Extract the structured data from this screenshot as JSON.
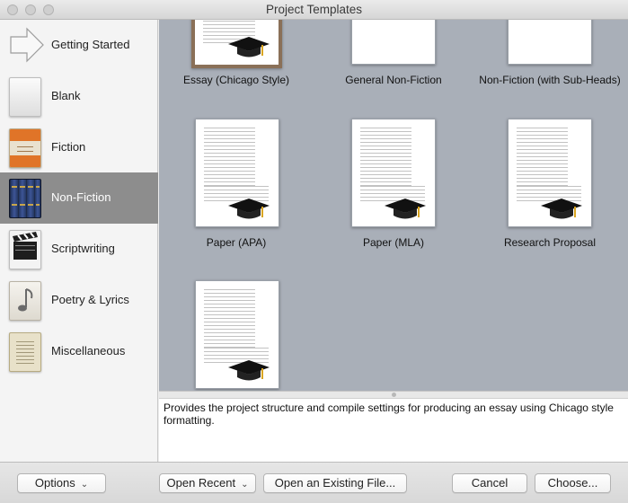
{
  "window": {
    "title": "Project Templates"
  },
  "sidebar": {
    "items": [
      {
        "label": "Getting Started",
        "icon": "arrow-icon"
      },
      {
        "label": "Blank",
        "icon": "blank-page-icon"
      },
      {
        "label": "Fiction",
        "icon": "fiction-book-icon"
      },
      {
        "label": "Non-Fiction",
        "icon": "nonfiction-books-icon",
        "selected": true
      },
      {
        "label": "Scriptwriting",
        "icon": "clapperboard-icon"
      },
      {
        "label": "Poetry & Lyrics",
        "icon": "music-note-icon"
      },
      {
        "label": "Miscellaneous",
        "icon": "parchment-icon"
      }
    ]
  },
  "templates": [
    {
      "label": "Essay (Chicago Style)",
      "selected": true
    },
    {
      "label": "General Non-Fiction"
    },
    {
      "label": "Non-Fiction (with Sub-Heads)"
    },
    {
      "label": "Paper (APA)"
    },
    {
      "label": "Paper (MLA)"
    },
    {
      "label": "Research Proposal"
    },
    {
      "label": ""
    }
  ],
  "description": "Provides the project structure and compile settings for producing an essay using Chicago style formatting.",
  "footer": {
    "options": "Options",
    "open_recent": "Open Recent",
    "open_existing": "Open an Existing File...",
    "cancel": "Cancel",
    "choose": "Choose..."
  },
  "colors": {
    "selected_sidebar": "#8d8d8d",
    "template_bg": "#a9afb8",
    "selection_border": "#8a7058"
  }
}
